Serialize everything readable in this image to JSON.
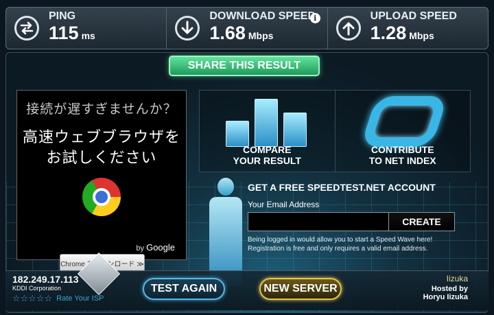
{
  "metrics": {
    "ping": {
      "label": "PING",
      "value": "115",
      "unit": "ms",
      "icon": "swap-arrows-icon"
    },
    "download": {
      "label": "DOWNLOAD SPEED",
      "value": "1.68",
      "unit": "Mbps",
      "icon": "arrow-down-icon",
      "info": "i"
    },
    "upload": {
      "label": "UPLOAD SPEED",
      "value": "1.28",
      "unit": "Mbps",
      "icon": "arrow-up-icon"
    }
  },
  "share_button": "SHARE THIS RESULT",
  "ad": {
    "question": "接続が遅すぎませんか？",
    "headline_1": "高速ウェブブラウザを",
    "headline_2": "お試しください",
    "download_button": "Chrome をダウンロード ≫",
    "byline_prefix": "by",
    "byline_brand": "Google"
  },
  "tiles": {
    "compare": {
      "line1": "COMPARE",
      "line2": "YOUR RESULT"
    },
    "contribute": {
      "line1": "CONTRIBUTE",
      "line2": "TO NET INDEX"
    }
  },
  "account": {
    "title": "GET A FREE SPEEDTEST.NET ACCOUNT",
    "email_label": "Your Email Address",
    "email_value": "",
    "create_button": "CREATE",
    "note_1": "Being logged in would allow you to start a Speed Wave here!",
    "note_2": "Registration is free and only requires a valid email address."
  },
  "isp": {
    "ip": "182.249.17.113",
    "name": "KDDI Corporation",
    "stars": "☆☆☆☆☆",
    "rate_label": "Rate Your ISP"
  },
  "buttons": {
    "test_again": "TEST AGAIN",
    "new_server": "NEW SERVER"
  },
  "server": {
    "city": "Iizuka",
    "hosted_label": "Hosted by",
    "host": "Horyu Iizuka"
  }
}
